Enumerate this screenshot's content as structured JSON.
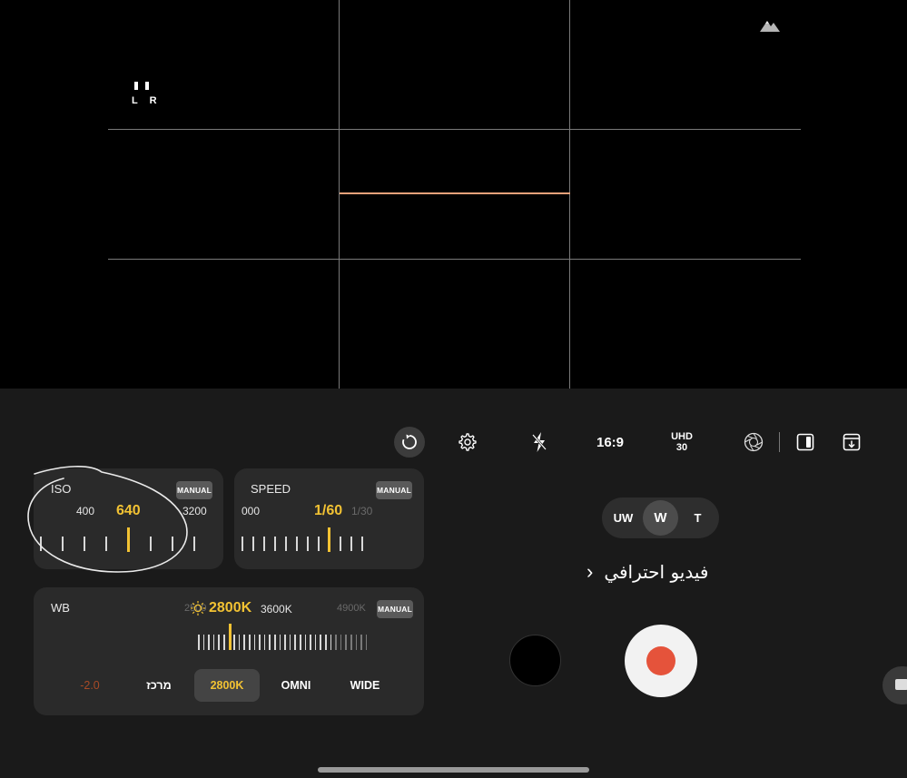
{
  "viewfinder": {
    "audio_channels": "L R"
  },
  "toolbar": {
    "aspect_ratio": "16:9",
    "resolution": "UHD",
    "frame_rate": "30"
  },
  "iso": {
    "label": "ISO",
    "mode": "MANUAL",
    "scale": {
      "left": "400",
      "current": "640",
      "right": "3200"
    }
  },
  "speed": {
    "label": "SPEED",
    "mode": "MANUAL",
    "scale": {
      "left": "000",
      "current": "1/60",
      "right": "1/30"
    }
  },
  "wb": {
    "label": "WB",
    "mode": "MANUAL",
    "scale": {
      "far_left": "2500",
      "current": "2800K",
      "right": "3600K",
      "far_right": "4900K"
    },
    "options": [
      "-2.0",
      "מרכז",
      "2800K",
      "OMNI",
      "WIDE"
    ],
    "selected_option": "2800K"
  },
  "lens": {
    "options": [
      "UW",
      "W",
      "T"
    ],
    "selected": "W"
  },
  "mode": {
    "name": "فيديو احترافي"
  },
  "colors": {
    "accent": "#f2c233",
    "record": "#e5533b",
    "level_line": "#e8a17a",
    "panel_bg": "#1a1a1a",
    "card_bg": "#2a2a2a"
  }
}
